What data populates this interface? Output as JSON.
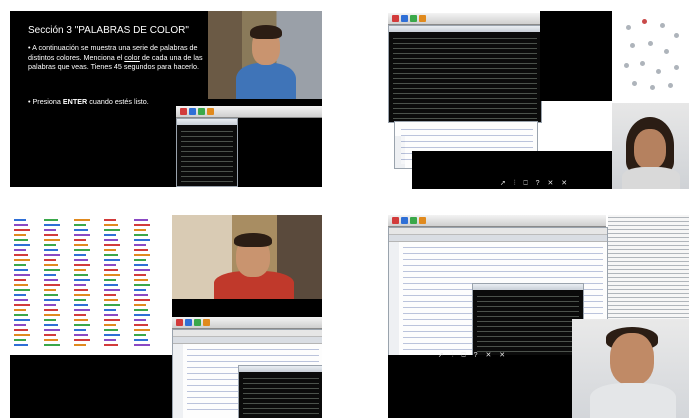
{
  "slide": {
    "title": "Sección 3 \"PALABRAS DE COLOR\"",
    "instruction_prefix": "• A continuación se muestra una serie de palabras de distintos colores. Menciona el ",
    "instruction_emph": "color",
    "instruction_suffix": " de cada una de las palabras que veas. Tienes 45 segundos para hacerlo.",
    "enter_prefix": "• Presiona ",
    "enter_key": "ENTER",
    "enter_suffix": " cuando estés listo."
  },
  "controls": {
    "top_right": "➚ ⫶ ⎕ ? ✕ ✕",
    "bottom_right": "➚ ⫶ ⎕ ? ✕ ✕"
  },
  "colors": {
    "black": "#000000",
    "white": "#ffffff",
    "word_colors": [
      "#2f6fd6",
      "#d23b3b",
      "#3aa84a",
      "#8a49c4",
      "#e08a1e"
    ]
  }
}
